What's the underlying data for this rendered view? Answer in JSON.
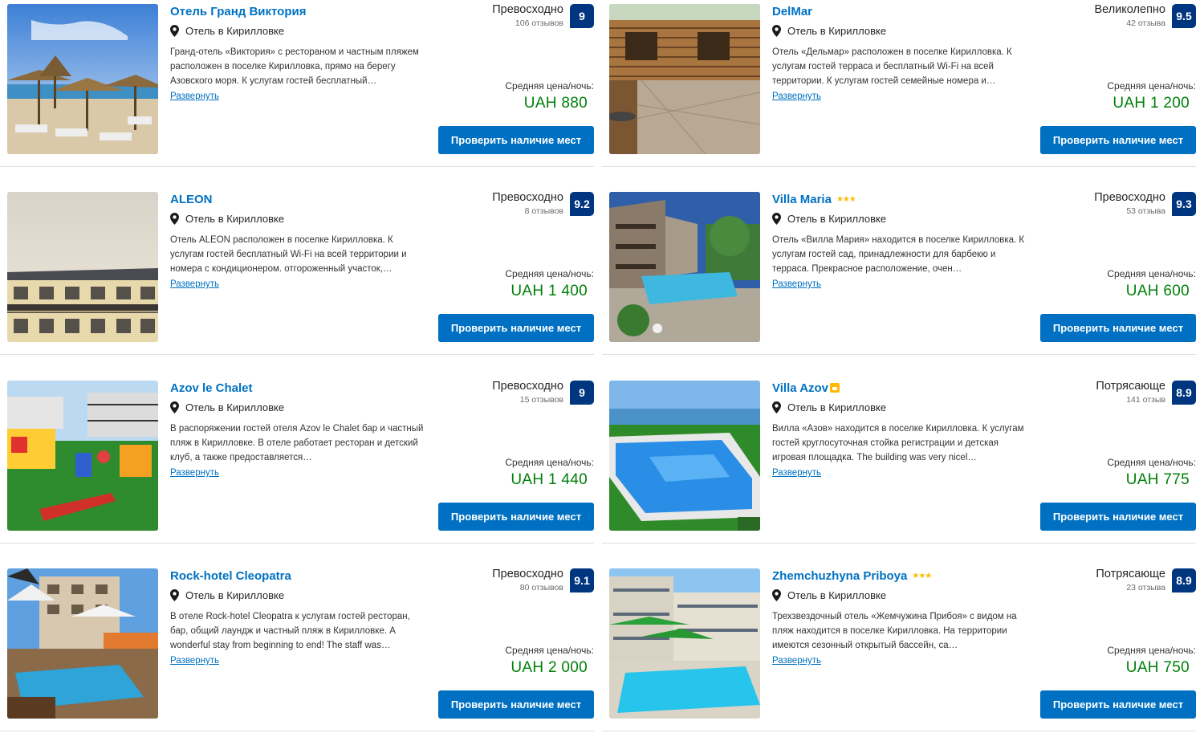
{
  "labels": {
    "avg_price": "Средняя цена/ночь:",
    "expand": "Развернуть",
    "check_button": "Проверить наличие мест"
  },
  "colors": {
    "brand": "#0071c2",
    "score_bg": "#003580",
    "price": "#008009",
    "stars": "#febb02"
  },
  "hotels": [
    {
      "name": "Отель Гранд Виктория",
      "location": "Отель в Кирилловке",
      "description": "Гранд-отель «Виктория» с рестораном и частным пляжем расположен в поселке Кирилловка, прямо на берегу Азовского моря. К услугам гостей бесплатный…",
      "rating_word": "Превосходно",
      "reviews": "106 отзывов",
      "score": "9",
      "price": "UAH 880",
      "image_icon": "beach-umbrellas-photo"
    },
    {
      "name": "DelMar",
      "location": "Отель в Кирилловке",
      "description": "Отель «Дельмар» расположен в поселке Кирилловка. К услугам гостей терраса и бесплатный Wi-Fi на всей территории. К услугам гостей семейные номера и…",
      "rating_word": "Великолепно",
      "reviews": "42 отзыва",
      "score": "9.5",
      "price": "UAH 1 200",
      "image_icon": "wooden-house-photo"
    },
    {
      "name": "ALEON",
      "location": "Отель в Кирилловке",
      "description": "Отель ALEON расположен в поселке Кирилловка. К услугам гостей бесплатный Wi-Fi на всей территории и номера с кондиционером. отгороженный участок,…",
      "rating_word": "Превосходно",
      "reviews": "8 отзывов",
      "score": "9.2",
      "price": "UAH 1 400",
      "image_icon": "building-balconies-photo"
    },
    {
      "name": "Villa Maria",
      "stars": "★★★",
      "location": "Отель в Кирилловке",
      "description": "Отель «Вилла Мария» находится в поселке Кирилловка. К услугам гостей сад, принадлежности для барбекю и терраса. Прекрасное расположение, очен…",
      "rating_word": "Превосходно",
      "reviews": "53 отзыва",
      "score": "9.3",
      "price": "UAH 600",
      "image_icon": "pool-courtyard-photo"
    },
    {
      "name": "Azov le Chalet",
      "location": "Отель в Кирилловке",
      "description": "В распоряжении гостей отеля Azov le Chalet бар и частный пляж в Кирилловке. В отеле работает ресторан и детский клуб, а также предоставляется…",
      "rating_word": "Превосходно",
      "reviews": "15 отзывов",
      "score": "9",
      "price": "UAH 1 440",
      "image_icon": "playground-photo"
    },
    {
      "name": "Villa Azov",
      "location": "Отель в Кирилловке",
      "description": "Вилла «Азов» находится в поселке Кирилловка. К услугам гостей круглосуточная стойка регистрации и детская игровая площадка. The building was very nicel…",
      "rating_word": "Потрясающе",
      "reviews": "141 отзыв",
      "score": "8.9",
      "price": "UAH 775",
      "image_icon": "pool-sea-photo"
    },
    {
      "name": "Rock-hotel Cleopatra",
      "location": "Отель в Кирилловке",
      "description": "В отеле Rock-hotel Cleopatra к услугам гостей ресторан, бар, общий лаундж и частный пляж в Кирилловке. A wonderful stay from beginning to end! The staff was…",
      "rating_word": "Превосходно",
      "reviews": "80 отзывов",
      "score": "9.1",
      "price": "UAH 2 000",
      "image_icon": "hotel-pool-umbrellas-photo"
    },
    {
      "name": "Zhemchuzhyna Priboya",
      "stars": "★★★",
      "location": "Отель в Кирилловке",
      "description": "Трехзвездочный отель «Жемчужина Прибоя» с видом на пляж находится в поселке Кирилловка. На территории имеются сезонный открытый бассейн, са…",
      "rating_word": "Потрясающе",
      "reviews": "23 отзыва",
      "score": "8.9",
      "price": "UAH 750",
      "image_icon": "hotel-pool-courtyard-photo"
    }
  ]
}
